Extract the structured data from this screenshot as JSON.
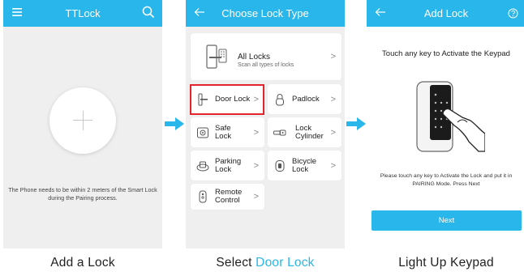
{
  "colors": {
    "accent": "#29b6ea",
    "highlight": "#e3252b",
    "screen_bg": "#efefef"
  },
  "screen1": {
    "title": "TTLock",
    "menu_icon": "hamburger-menu-icon",
    "search_icon": "search-icon",
    "add_icon": "plus-icon",
    "hint": "The Phone needs to be within 2 meters of the Smart Lock during the Pairing process."
  },
  "screen2": {
    "title": "Choose Lock Type",
    "back_icon": "back-arrow-icon",
    "all_locks": {
      "label": "All Locks",
      "sub": "Scan all types of locks"
    },
    "types": [
      {
        "label": "Door Lock"
      },
      {
        "label": "Padlock"
      },
      {
        "label": "Safe Lock"
      },
      {
        "label": "Lock Cylinder"
      },
      {
        "label": "Parking Lock"
      },
      {
        "label": "Bicycle Lock"
      },
      {
        "label": "Remote Control"
      }
    ],
    "chevron": ">"
  },
  "screen3": {
    "title": "Add Lock",
    "back_icon": "back-arrow-icon",
    "help_icon": "help-icon",
    "heading": "Touch any key to Activate the Keypad",
    "hint": "Please touch any key to Activate the Lock and put it in PAIRING Mode. Press Next",
    "next_label": "Next"
  },
  "captions": {
    "step1": "Add a Lock",
    "step2_prefix": "Select",
    "step2_accent": "Door Lock",
    "step3": "Light Up Keypad"
  }
}
